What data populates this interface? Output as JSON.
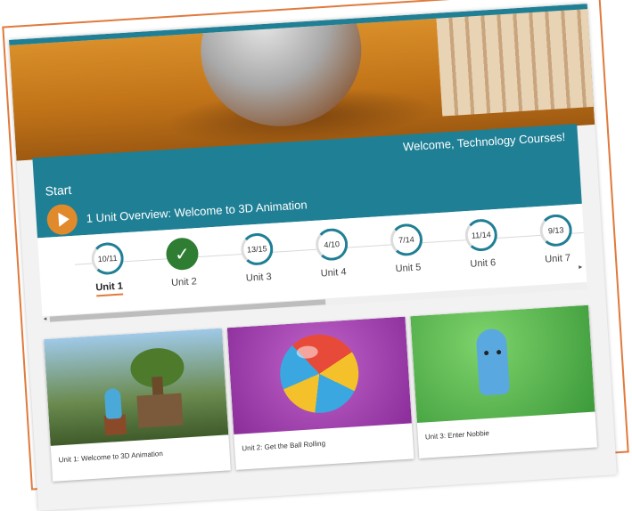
{
  "header": {
    "welcome": "Welcome, Technology Courses!",
    "start_label": "Start",
    "current_lesson": "1 Unit Overview: Welcome to 3D Animation"
  },
  "units": [
    {
      "label": "Unit 1",
      "progress": "10/11",
      "complete": false,
      "active": true
    },
    {
      "label": "Unit 2",
      "progress": "",
      "complete": true,
      "active": false
    },
    {
      "label": "Unit 3",
      "progress": "13/15",
      "complete": false,
      "active": false
    },
    {
      "label": "Unit 4",
      "progress": "4/10",
      "complete": false,
      "active": false
    },
    {
      "label": "Unit 5",
      "progress": "7/14",
      "complete": false,
      "active": false
    },
    {
      "label": "Unit 6",
      "progress": "11/14",
      "complete": false,
      "active": false
    },
    {
      "label": "Unit 7",
      "progress": "9/13",
      "complete": false,
      "active": false
    }
  ],
  "cards": [
    {
      "title": "Unit 1: Welcome to 3D Animation"
    },
    {
      "title": "Unit 2: Get the Ball Rolling"
    },
    {
      "title": "Unit 3: Enter Nobbie"
    }
  ],
  "colors": {
    "accent": "#1f7f95",
    "orange": "#e07a3c",
    "complete": "#2e7d32"
  }
}
